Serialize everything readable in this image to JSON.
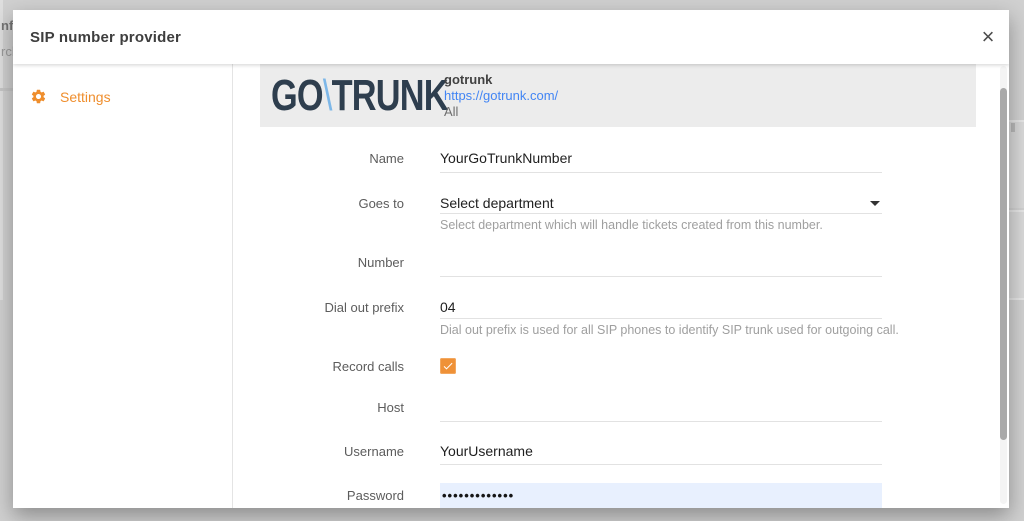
{
  "background": {
    "fragment_top": "nfig",
    "fragment_bottom": "rch"
  },
  "modal": {
    "title": "SIP number provider",
    "close_icon": "×"
  },
  "sidebar": {
    "settings_label": "Settings"
  },
  "provider": {
    "logo_go": "GO",
    "logo_slash": "\\",
    "logo_trunk": "TRUNK",
    "name": "gotrunk",
    "url": "https://gotrunk.com/",
    "visibility": "All"
  },
  "form": {
    "name_label": "Name",
    "name_value": "YourGoTrunkNumber",
    "goes_to_label": "Goes to",
    "goes_to_value": "Select department",
    "goes_to_helper": "Select department which will handle tickets created from this number.",
    "number_label": "Number",
    "number_value": "",
    "dial_label": "Dial out prefix",
    "dial_value": "04",
    "dial_helper": "Dial out prefix is used for all SIP phones to identify SIP trunk used for outgoing call.",
    "record_label": "Record calls",
    "record_checked": true,
    "host_label": "Host",
    "host_value": "",
    "username_label": "Username",
    "username_value": "YourUsername",
    "password_label": "Password",
    "password_value": "•••••••••••••"
  },
  "colors": {
    "accent_orange": "#ef8e2d",
    "checkbox_orange": "#ef9137",
    "link_blue": "#4285f4",
    "logo_navy": "#2e3e4e",
    "logo_slash_blue": "#7db7e8",
    "autofill_blue": "#e8f0fe",
    "band_gray": "#ececec"
  }
}
